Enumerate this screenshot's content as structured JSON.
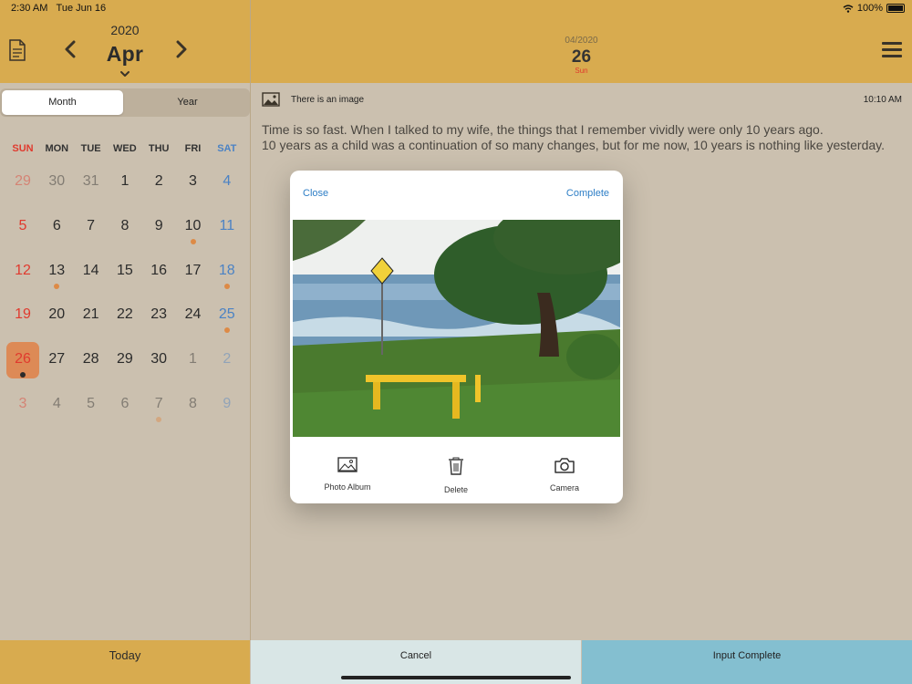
{
  "status_bar": {
    "time": "2:30 AM",
    "date": "Tue Jun 16",
    "battery": "100%"
  },
  "calendar_header": {
    "year": "2020",
    "month": "Apr",
    "icons": [
      "document-icon",
      "chevron-left-icon",
      "chevron-right-icon",
      "chevron-down-icon"
    ]
  },
  "entry_header": {
    "date_small": "04/2020",
    "day": "26",
    "weekday": "Sun",
    "menu_icon": "hamburger-menu-icon"
  },
  "view_toggle": {
    "month_label": "Month",
    "year_label": "Year",
    "selected": "Month"
  },
  "calendar": {
    "weekdays": [
      "SUN",
      "MON",
      "TUE",
      "WED",
      "THU",
      "FRI",
      "SAT"
    ],
    "weeks": [
      [
        {
          "d": "29",
          "o": true
        },
        {
          "d": "30",
          "o": true
        },
        {
          "d": "31",
          "o": true
        },
        {
          "d": "1"
        },
        {
          "d": "2"
        },
        {
          "d": "3"
        },
        {
          "d": "4"
        }
      ],
      [
        {
          "d": "5"
        },
        {
          "d": "6"
        },
        {
          "d": "7"
        },
        {
          "d": "8"
        },
        {
          "d": "9"
        },
        {
          "d": "10",
          "dot": true
        },
        {
          "d": "11"
        }
      ],
      [
        {
          "d": "12"
        },
        {
          "d": "13",
          "dot": true
        },
        {
          "d": "14"
        },
        {
          "d": "15"
        },
        {
          "d": "16"
        },
        {
          "d": "17"
        },
        {
          "d": "18",
          "dot": true
        }
      ],
      [
        {
          "d": "19"
        },
        {
          "d": "20"
        },
        {
          "d": "21"
        },
        {
          "d": "22"
        },
        {
          "d": "23"
        },
        {
          "d": "24"
        },
        {
          "d": "25",
          "dot": true
        }
      ],
      [
        {
          "d": "26",
          "selected": true,
          "dot": true
        },
        {
          "d": "27"
        },
        {
          "d": "28"
        },
        {
          "d": "29"
        },
        {
          "d": "30"
        },
        {
          "d": "1",
          "o": true
        },
        {
          "d": "2",
          "o": true
        }
      ],
      [
        {
          "d": "3",
          "o": true
        },
        {
          "d": "4",
          "o": true
        },
        {
          "d": "5",
          "o": true
        },
        {
          "d": "6",
          "o": true
        },
        {
          "d": "7",
          "o": true,
          "dot": true
        },
        {
          "d": "8",
          "o": true
        },
        {
          "d": "9",
          "o": true
        }
      ]
    ]
  },
  "entry": {
    "image_note": "There is an image",
    "time": "10:10 AM",
    "lines": [
      "Time is so fast. When I talked to my wife, the things that I remember vividly were only 10 years ago.",
      "10 years as a child was a continuation of so many changes, but for me now, 10 years is nothing like yesterday."
    ]
  },
  "image_modal": {
    "close_label": "Close",
    "complete_label": "Complete",
    "actions": [
      {
        "label": "Photo Album",
        "icon": "photo-album-icon"
      },
      {
        "label": "Delete",
        "icon": "trash-icon"
      },
      {
        "label": "Camera",
        "icon": "camera-icon"
      }
    ]
  },
  "bottom_bar": {
    "today_label": "Today",
    "cancel_label": "Cancel",
    "input_complete_label": "Input Complete"
  },
  "colors": {
    "header_gold": "#d8ab4f",
    "background": "#cbc0af",
    "sunday_red": "#e03a2e",
    "saturday_blue": "#4b82c4",
    "accent_orange": "#dd8a56",
    "link_blue": "#2d7ec6",
    "input_complete_blue": "#84bfd0",
    "cancel_gray": "#d9e6e6"
  }
}
